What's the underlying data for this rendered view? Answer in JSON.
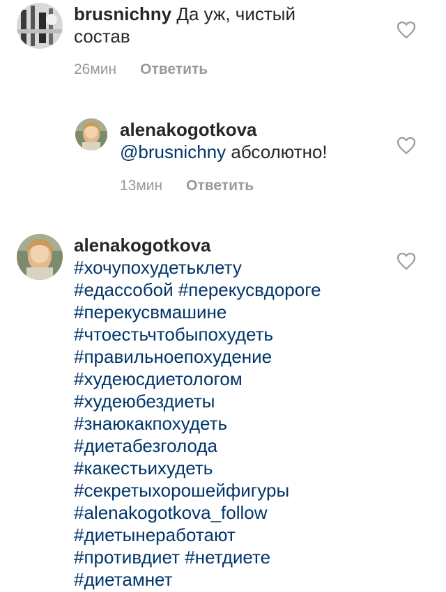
{
  "comments": [
    {
      "username": "brusnichny",
      "text_line1": " Да уж, чистый",
      "text_line2": "состав",
      "time": "26мин",
      "reply": "Ответить",
      "avatar_icon": "avatar-brusnichny-icon"
    },
    {
      "username": "alenakogotkova",
      "mention": "@brusnichny",
      "text": " абсолютно!",
      "time": "13мин",
      "reply": "Ответить",
      "avatar_icon": "avatar-alenakogotkova-icon"
    },
    {
      "username": "alenakogotkova",
      "hashtag_lines": [
        "#хочупохудетьклету",
        "#едассобой #перекусвдороге",
        "#перекусвмашине",
        "#чтоестьчтобыпохудеть",
        "#правильноепохудение",
        "#худеюсдиетологом",
        "#худеюбездиеты",
        "#знаюкакпохудеть",
        "#диетабезголода",
        "#какестьихудеть",
        "#секретыхорошейфигуры",
        "#alenakogotkova_follow",
        "#диетынеработают",
        "#противдиет #нетдиете",
        "#диетамнет"
      ],
      "avatar_icon": "avatar-alenakogotkova-icon"
    }
  ],
  "colors": {
    "text": "#262626",
    "link": "#003569",
    "meta": "#999999",
    "heart": "#9b9b9b"
  },
  "icons": {
    "like": "heart-icon"
  }
}
